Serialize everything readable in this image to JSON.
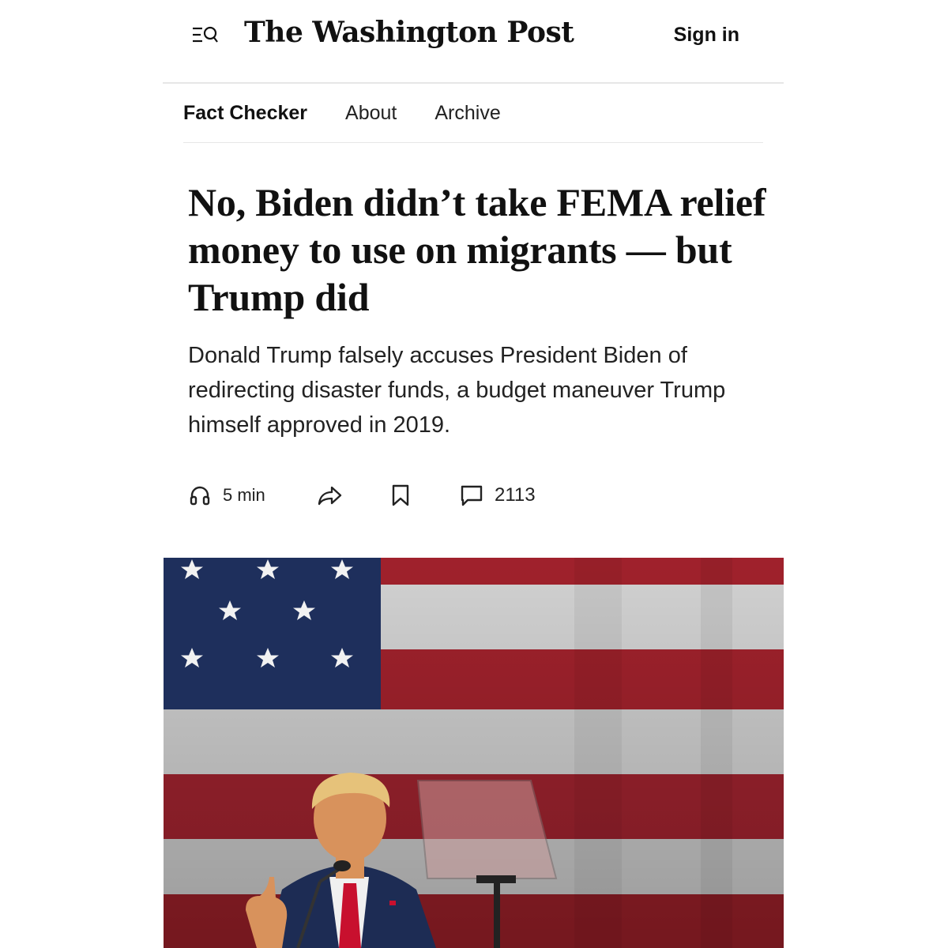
{
  "masthead": {
    "logo_text": "The Washington Post",
    "sign_in_label": "Sign in",
    "menu_icon": "menu-search-icon"
  },
  "subnav": {
    "items": [
      {
        "label": "Fact Checker",
        "active": true
      },
      {
        "label": "About",
        "active": false
      },
      {
        "label": "Archive",
        "active": false
      }
    ]
  },
  "article": {
    "headline": "No, Biden didn’t take FEMA relief money to use on migrants — but Trump did",
    "dek": "Donald Trump falsely accuses President Biden of redirecting disaster funds, a budget maneuver Trump himself approved in 2019."
  },
  "actions": {
    "listen": {
      "icon": "headphones-icon",
      "label": "5 min"
    },
    "share": {
      "icon": "share-icon"
    },
    "save": {
      "icon": "bookmark-icon"
    },
    "comments": {
      "icon": "comment-icon",
      "count": "2113"
    }
  },
  "photo": {
    "description_icon": "hero-photo"
  },
  "colors": {
    "flag_red": "#a8232e",
    "flag_white": "#dcdcdc",
    "flag_blue": "#1e2f5c",
    "divider": "#e6e6e6"
  }
}
